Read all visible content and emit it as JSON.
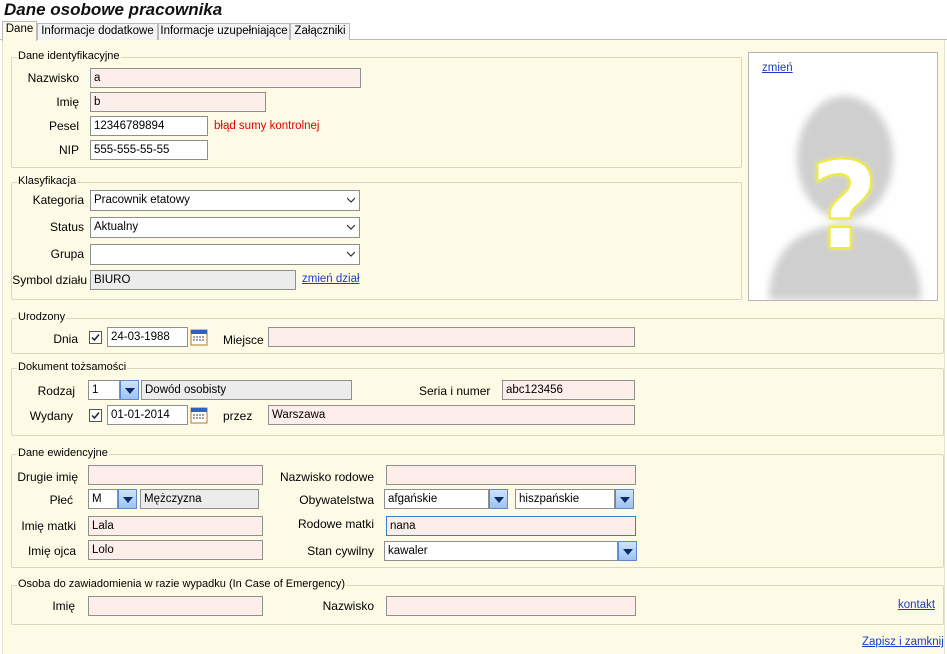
{
  "title": "Dane osobowe pracownika",
  "tabs": [
    "Dane",
    "Informacje dodatkowe",
    "Informacje uzupełniające",
    "Załączniki"
  ],
  "identyfikacja": {
    "legend": "Dane identyfikacyjne",
    "nazwisko_label": "Nazwisko",
    "nazwisko": "a",
    "imie_label": "Imię",
    "imie": "b",
    "pesel_label": "Pesel",
    "pesel": "12346789894",
    "pesel_error": "błąd sumy kontrolnej",
    "nip_label": "NIP",
    "nip": "555-555-55-55"
  },
  "photo": {
    "change_link": "zmień",
    "icon": "unknown-person-silhouette-question-mark"
  },
  "klasyfikacja": {
    "legend": "Klasyfikacja",
    "kategoria_label": "Kategoria",
    "kategoria": "Pracownik etatowy",
    "status_label": "Status",
    "status": "Aktualny",
    "grupa_label": "Grupa",
    "grupa": "",
    "symbol_label": "Symbol działu",
    "symbol": "BIURO",
    "zmien_dzial": "zmień dział"
  },
  "urodzony": {
    "legend": "Urodzony",
    "dnia_label": "Dnia",
    "dnia": "24-03-1988",
    "dnia_checked": true,
    "miejsce_label": "Miejsce",
    "miejsce": ""
  },
  "dokument": {
    "legend": "Dokument tożsamości",
    "rodzaj_label": "Rodzaj",
    "rodzaj_code": "1",
    "rodzaj_name": "Dowód osobisty",
    "seria_label": "Seria i numer",
    "seria": "abc123456",
    "wydany_label": "Wydany",
    "wydany": "01-01-2014",
    "wydany_checked": true,
    "przez_label": "przez",
    "przez": "Warszawa"
  },
  "ewidencja": {
    "legend": "Dane ewidencyjne",
    "drugie_imie_label": "Drugie imię",
    "drugie_imie": "",
    "nazwisko_rodowe_label": "Nazwisko rodowe",
    "nazwisko_rodowe": "",
    "plec_label": "Płeć",
    "plec_code": "M",
    "plec_name": "Mężczyzna",
    "obywatelstwa_label": "Obywatelstwa",
    "obywatelstwo1": "afgańskie",
    "obywatelstwo2": "hiszpańskie",
    "imie_matki_label": "Imię matki",
    "imie_matki": "Lala",
    "rodowe_matki_label": "Rodowe matki",
    "rodowe_matki": "nana",
    "imie_ojca_label": "Imię ojca",
    "imie_ojca": "Lolo",
    "stan_label": "Stan cywilny",
    "stan": "kawaler"
  },
  "emergency": {
    "legend": "Osoba do zawiadomienia w razie wypadku (In Case of Emergency)",
    "imie_label": "Imię",
    "imie": "",
    "nazwisko_label": "Nazwisko",
    "nazwisko": "",
    "kontakt": "kontakt"
  },
  "footer": {
    "save_close": "Zapisz i zamknij"
  },
  "colors": {
    "panel": "#fdfbe6",
    "link": "#1a3cc9",
    "error": "#e00000",
    "required_field": "#fdeeea"
  }
}
